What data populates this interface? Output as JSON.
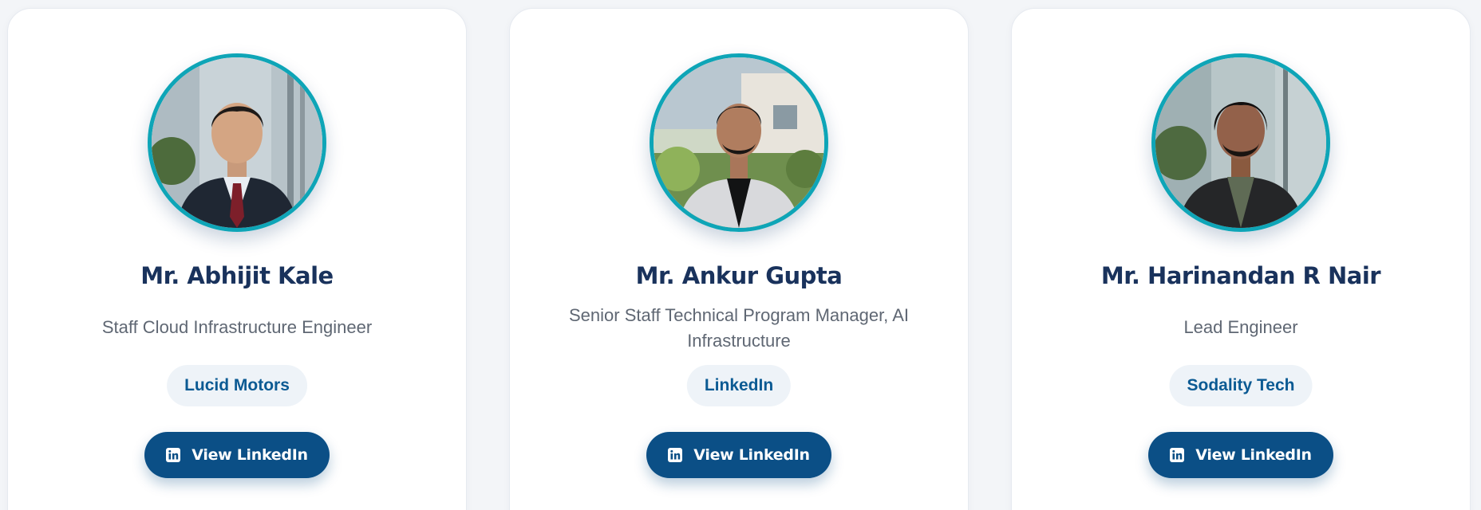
{
  "profiles": [
    {
      "name": "Mr. Abhijit Kale",
      "role": "Staff Cloud Infrastructure Engineer",
      "company": "Lucid Motors",
      "button_label": "View LinkedIn",
      "icon": "linkedin-icon"
    },
    {
      "name": "Mr. Ankur Gupta",
      "role": "Senior Staff Technical Program Manager, AI Infrastructure",
      "company": "LinkedIn",
      "button_label": "View LinkedIn",
      "icon": "linkedin-icon"
    },
    {
      "name": "Mr. Harinandan R Nair",
      "role": "Lead Engineer",
      "company": "Sodality Tech",
      "button_label": "View LinkedIn",
      "icon": "linkedin-icon"
    }
  ],
  "colors": {
    "name_text": "#19325c",
    "role_text": "#5f6773",
    "company_text": "#0b5a93",
    "company_bg": "#eef3f8",
    "button_bg": "#0b4f86",
    "avatar_ring": "#0ea5b7"
  }
}
